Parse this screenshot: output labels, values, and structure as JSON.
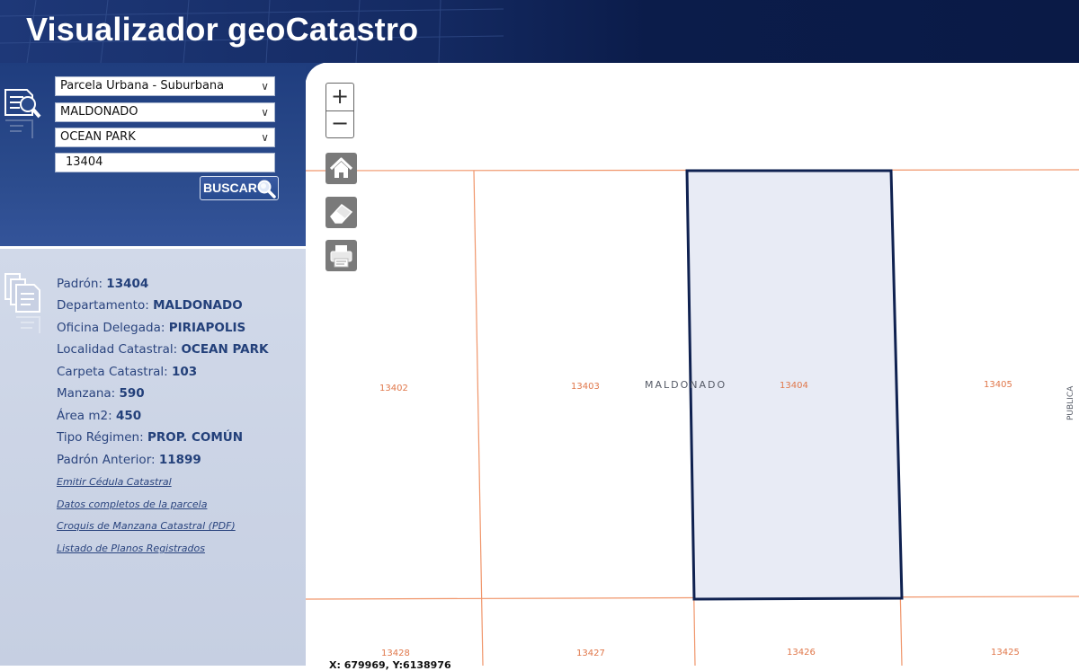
{
  "header": {
    "title": "Visualizador geoCatastro"
  },
  "search": {
    "type_select": "Parcela Urbana - Suburbana",
    "department_select": "MALDONADO",
    "locality_select": "OCEAN PARK",
    "padron_value": "13404",
    "button_label": "BUSCAR"
  },
  "info": {
    "rows": [
      {
        "label": "Padrón:",
        "value": "13404"
      },
      {
        "label": "Departamento:",
        "value": "MALDONADO"
      },
      {
        "label": "Oficina Delegada:",
        "value": "PIRIAPOLIS"
      },
      {
        "label": "Localidad Catastral:",
        "value": "OCEAN PARK"
      },
      {
        "label": "Carpeta Catastral:",
        "value": "103"
      },
      {
        "label": "Manzana:",
        "value": "590"
      },
      {
        "label": "Área m2:",
        "value": "450"
      },
      {
        "label": "Tipo Régimen:",
        "value": "PROP. COMÚN"
      },
      {
        "label": "Padrón Anterior:",
        "value": "11899"
      }
    ],
    "links": [
      "Emitir Cédula Catastral",
      "Datos completos de la parcela",
      "Croquis de Manzana Catastral (PDF)",
      "Listado de Planos Registrados"
    ]
  },
  "map": {
    "zoom_in": "+",
    "zoom_out": "−",
    "zone_label": "MALDONADO",
    "street_label": "PUBLICA",
    "parcels": [
      "13402",
      "13403",
      "13404",
      "13405",
      "13428",
      "13427",
      "13426",
      "13425"
    ],
    "coords": "X: 679969, Y:6138976",
    "colors": {
      "parcel_line": "#f0956a",
      "selected_border": "#0f2150",
      "selected_fill": "#e8ebf5"
    }
  },
  "icons": [
    "search-document-icon",
    "documents-icon",
    "home-icon",
    "eraser-icon",
    "printer-icon",
    "magnifier-icon",
    "chevron-down-icon"
  ]
}
